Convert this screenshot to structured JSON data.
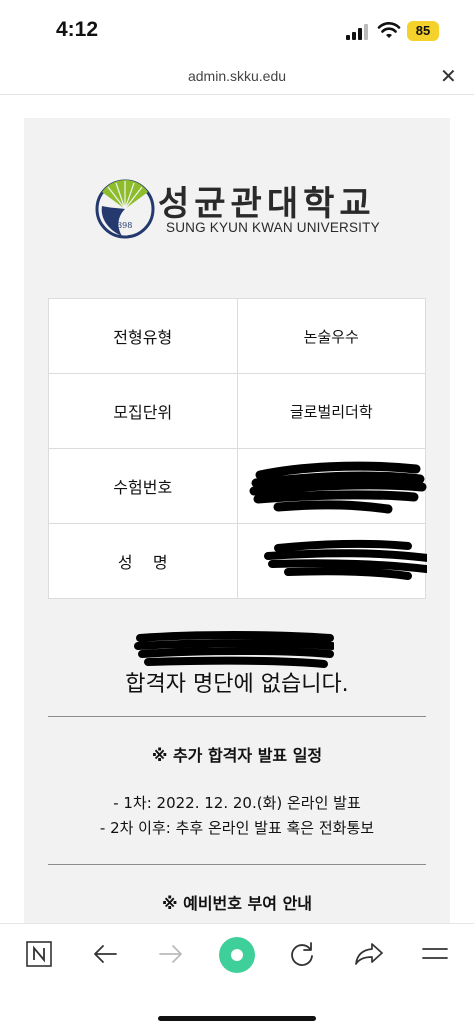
{
  "status": {
    "time": "4:12",
    "battery": "85"
  },
  "browser": {
    "url": "admin.skku.edu"
  },
  "logo": {
    "korean": "성균관대학교",
    "english": "SUNG KYUN KWAN UNIVERSITY",
    "year": "1398"
  },
  "info_table": {
    "rows": [
      {
        "label": "전형유형",
        "value": "논술우수"
      },
      {
        "label": "모집단위",
        "value": "글로벌리더학"
      },
      {
        "label": "수험번호",
        "value": ""
      },
      {
        "label": "성    명",
        "value": ""
      }
    ]
  },
  "result": {
    "message": "합격자 명단에 없습니다."
  },
  "additional": {
    "title": "※ 추가 합격자 발표 일정",
    "line1": "- 1차: 2022. 12. 20.(화) 온라인 발표",
    "line2": "- 2차 이후: 추후 온라인 발표 혹은 전화통보"
  },
  "waitlist": {
    "title": "※ 예비번호 부여 안내"
  },
  "colors": {
    "battery": "#f5d12b",
    "accent": "#3ecf9a",
    "logo_navy": "#243a6e"
  }
}
